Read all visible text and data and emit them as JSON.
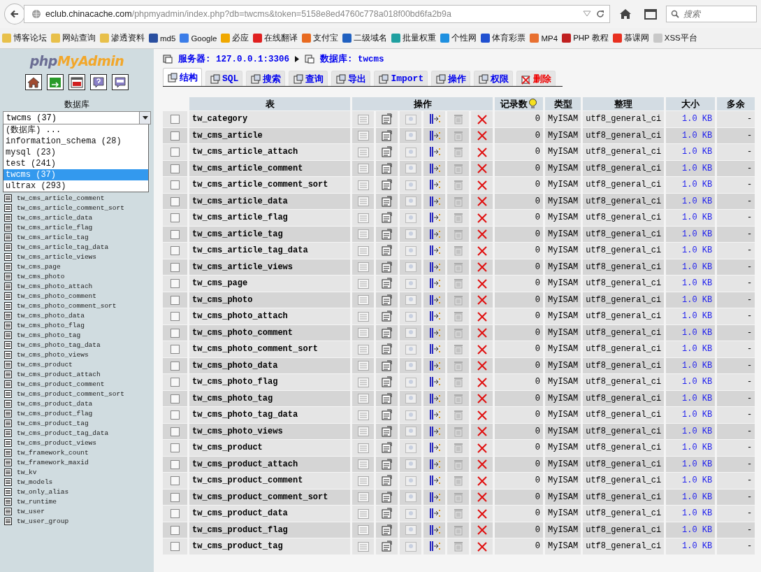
{
  "browser": {
    "url_host": "eclub.chinacache.com",
    "url_path": "/phpmyadmin/index.php?db=twcms&token=5158e8ed4760c778a018f00bd6fa2b9a",
    "search_placeholder": "搜索",
    "bookmarks": [
      {
        "label": "博客论坛",
        "color": "#e8c04a"
      },
      {
        "label": "网站查询",
        "color": "#e8c04a"
      },
      {
        "label": "渗透资料",
        "color": "#e8c04a"
      },
      {
        "label": "md5",
        "color": "#2a4fa0"
      },
      {
        "label": "Google",
        "color": "#3b7de8"
      },
      {
        "label": "必应",
        "color": "#f0a800"
      },
      {
        "label": "在线翻译",
        "color": "#e02020"
      },
      {
        "label": "支付宝",
        "color": "#e86a20"
      },
      {
        "label": "二级域名",
        "color": "#2060c0"
      },
      {
        "label": "批量权重",
        "color": "#20a0a0"
      },
      {
        "label": "个性网",
        "color": "#1e90e0"
      },
      {
        "label": "体育彩票",
        "color": "#2050d0"
      },
      {
        "label": "MP4",
        "color": "#e87030"
      },
      {
        "label": "PHP 教程",
        "color": "#c02020"
      },
      {
        "label": "慕课网",
        "color": "#e83020"
      },
      {
        "label": "XSS平台",
        "color": "#c8c8c8"
      }
    ]
  },
  "sidebar": {
    "logo": {
      "php": "php",
      "rest": "MyAdmin"
    },
    "database_label": "数据库",
    "select_value": "twcms (37)",
    "dropdown_options": [
      {
        "label": "(数据库) ...",
        "selected": false
      },
      {
        "label": "information_schema (28)",
        "selected": false
      },
      {
        "label": "mysql (23)",
        "selected": false
      },
      {
        "label": "test (241)",
        "selected": false
      },
      {
        "label": "twcms (37)",
        "selected": true
      },
      {
        "label": "ultrax (293)",
        "selected": false
      }
    ],
    "tables": [
      "tw_cms_article_comment",
      "tw_cms_article_comment_sort",
      "tw_cms_article_data",
      "tw_cms_article_flag",
      "tw_cms_article_tag",
      "tw_cms_article_tag_data",
      "tw_cms_article_views",
      "tw_cms_page",
      "tw_cms_photo",
      "tw_cms_photo_attach",
      "tw_cms_photo_comment",
      "tw_cms_photo_comment_sort",
      "tw_cms_photo_data",
      "tw_cms_photo_flag",
      "tw_cms_photo_tag",
      "tw_cms_photo_tag_data",
      "tw_cms_photo_views",
      "tw_cms_product",
      "tw_cms_product_attach",
      "tw_cms_product_comment",
      "tw_cms_product_comment_sort",
      "tw_cms_product_data",
      "tw_cms_product_flag",
      "tw_cms_product_tag",
      "tw_cms_product_tag_data",
      "tw_cms_product_views",
      "tw_framework_count",
      "tw_framework_maxid",
      "tw_kv",
      "tw_models",
      "tw_only_alias",
      "tw_runtime",
      "tw_user",
      "tw_user_group"
    ]
  },
  "breadcrumb": {
    "server": "服务器: 127.0.0.1:3306",
    "database": "数据库: twcms"
  },
  "tabs": [
    {
      "label": "结构",
      "selected": true,
      "kind": "normal"
    },
    {
      "label": "SQL",
      "selected": false,
      "kind": "normal"
    },
    {
      "label": "搜索",
      "selected": false,
      "kind": "normal"
    },
    {
      "label": "查询",
      "selected": false,
      "kind": "normal"
    },
    {
      "label": "导出",
      "selected": false,
      "kind": "normal"
    },
    {
      "label": "Import",
      "selected": false,
      "kind": "normal"
    },
    {
      "label": "操作",
      "selected": false,
      "kind": "normal"
    },
    {
      "label": "权限",
      "selected": false,
      "kind": "normal"
    },
    {
      "label": "删除",
      "selected": false,
      "kind": "danger"
    }
  ],
  "table": {
    "columns": [
      "表",
      "操作",
      "记录数",
      "类型",
      "整理",
      "大小",
      "多余"
    ],
    "rows": [
      {
        "name": "tw_category",
        "checked": false,
        "records": "0",
        "type": "MyISAM",
        "collation": "utf8_general_ci",
        "size": "1.0 KB",
        "overhead": "-"
      },
      {
        "name": "tw_cms_article",
        "checked": false,
        "records": "0",
        "type": "MyISAM",
        "collation": "utf8_general_ci",
        "size": "1.0 KB",
        "overhead": "-"
      },
      {
        "name": "tw_cms_article_attach",
        "checked": false,
        "records": "0",
        "type": "MyISAM",
        "collation": "utf8_general_ci",
        "size": "1.0 KB",
        "overhead": "-"
      },
      {
        "name": "tw_cms_article_comment",
        "checked": false,
        "records": "0",
        "type": "MyISAM",
        "collation": "utf8_general_ci",
        "size": "1.0 KB",
        "overhead": "-"
      },
      {
        "name": "tw_cms_article_comment_sort",
        "checked": false,
        "records": "0",
        "type": "MyISAM",
        "collation": "utf8_general_ci",
        "size": "1.0 KB",
        "overhead": "-"
      },
      {
        "name": "tw_cms_article_data",
        "checked": false,
        "records": "0",
        "type": "MyISAM",
        "collation": "utf8_general_ci",
        "size": "1.0 KB",
        "overhead": "-"
      },
      {
        "name": "tw_cms_article_flag",
        "checked": false,
        "records": "0",
        "type": "MyISAM",
        "collation": "utf8_general_ci",
        "size": "1.0 KB",
        "overhead": "-"
      },
      {
        "name": "tw_cms_article_tag",
        "checked": false,
        "records": "0",
        "type": "MyISAM",
        "collation": "utf8_general_ci",
        "size": "1.0 KB",
        "overhead": "-"
      },
      {
        "name": "tw_cms_article_tag_data",
        "checked": false,
        "records": "0",
        "type": "MyISAM",
        "collation": "utf8_general_ci",
        "size": "1.0 KB",
        "overhead": "-"
      },
      {
        "name": "tw_cms_article_views",
        "checked": false,
        "records": "0",
        "type": "MyISAM",
        "collation": "utf8_general_ci",
        "size": "1.0 KB",
        "overhead": "-"
      },
      {
        "name": "tw_cms_page",
        "checked": false,
        "records": "0",
        "type": "MyISAM",
        "collation": "utf8_general_ci",
        "size": "1.0 KB",
        "overhead": "-"
      },
      {
        "name": "tw_cms_photo",
        "checked": false,
        "records": "0",
        "type": "MyISAM",
        "collation": "utf8_general_ci",
        "size": "1.0 KB",
        "overhead": "-"
      },
      {
        "name": "tw_cms_photo_attach",
        "checked": false,
        "records": "0",
        "type": "MyISAM",
        "collation": "utf8_general_ci",
        "size": "1.0 KB",
        "overhead": "-"
      },
      {
        "name": "tw_cms_photo_comment",
        "checked": false,
        "records": "0",
        "type": "MyISAM",
        "collation": "utf8_general_ci",
        "size": "1.0 KB",
        "overhead": "-"
      },
      {
        "name": "tw_cms_photo_comment_sort",
        "checked": false,
        "records": "0",
        "type": "MyISAM",
        "collation": "utf8_general_ci",
        "size": "1.0 KB",
        "overhead": "-"
      },
      {
        "name": "tw_cms_photo_data",
        "checked": false,
        "records": "0",
        "type": "MyISAM",
        "collation": "utf8_general_ci",
        "size": "1.0 KB",
        "overhead": "-"
      },
      {
        "name": "tw_cms_photo_flag",
        "checked": false,
        "records": "0",
        "type": "MyISAM",
        "collation": "utf8_general_ci",
        "size": "1.0 KB",
        "overhead": "-"
      },
      {
        "name": "tw_cms_photo_tag",
        "checked": false,
        "records": "0",
        "type": "MyISAM",
        "collation": "utf8_general_ci",
        "size": "1.0 KB",
        "overhead": "-"
      },
      {
        "name": "tw_cms_photo_tag_data",
        "checked": false,
        "records": "0",
        "type": "MyISAM",
        "collation": "utf8_general_ci",
        "size": "1.0 KB",
        "overhead": "-"
      },
      {
        "name": "tw_cms_photo_views",
        "checked": false,
        "records": "0",
        "type": "MyISAM",
        "collation": "utf8_general_ci",
        "size": "1.0 KB",
        "overhead": "-"
      },
      {
        "name": "tw_cms_product",
        "checked": false,
        "records": "0",
        "type": "MyISAM",
        "collation": "utf8_general_ci",
        "size": "1.0 KB",
        "overhead": "-"
      },
      {
        "name": "tw_cms_product_attach",
        "checked": false,
        "records": "0",
        "type": "MyISAM",
        "collation": "utf8_general_ci",
        "size": "1.0 KB",
        "overhead": "-"
      },
      {
        "name": "tw_cms_product_comment",
        "checked": false,
        "records": "0",
        "type": "MyISAM",
        "collation": "utf8_general_ci",
        "size": "1.0 KB",
        "overhead": "-"
      },
      {
        "name": "tw_cms_product_comment_sort",
        "checked": false,
        "records": "0",
        "type": "MyISAM",
        "collation": "utf8_general_ci",
        "size": "1.0 KB",
        "overhead": "-"
      },
      {
        "name": "tw_cms_product_data",
        "checked": false,
        "records": "0",
        "type": "MyISAM",
        "collation": "utf8_general_ci",
        "size": "1.0 KB",
        "overhead": "-"
      },
      {
        "name": "tw_cms_product_flag",
        "checked": false,
        "records": "0",
        "type": "MyISAM",
        "collation": "utf8_general_ci",
        "size": "1.0 KB",
        "overhead": "-"
      },
      {
        "name": "tw_cms_product_tag",
        "checked": false,
        "records": "0",
        "type": "MyISAM",
        "collation": "utf8_general_ci",
        "size": "1.0 KB",
        "overhead": "-"
      }
    ]
  }
}
